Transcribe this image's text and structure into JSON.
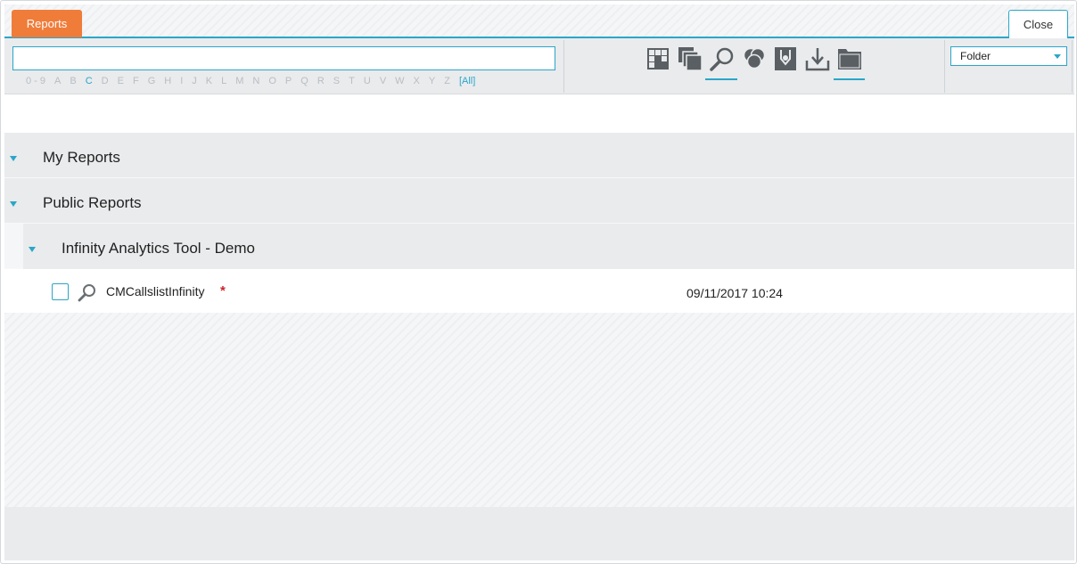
{
  "tabs": {
    "reports_label": "Reports",
    "close_label": "Close"
  },
  "search": {
    "value": "",
    "placeholder": ""
  },
  "alpha_filter": {
    "letters": [
      "0 - 9",
      "A",
      "B",
      "C",
      "D",
      "E",
      "F",
      "G",
      "H",
      "I",
      "J",
      "K",
      "L",
      "M",
      "N",
      "O",
      "P",
      "Q",
      "R",
      "S",
      "T",
      "U",
      "V",
      "W",
      "X",
      "Y",
      "Z",
      "[All]"
    ],
    "active": "C"
  },
  "toolbar_icons": [
    "grid-icon",
    "stacked-copy-icon",
    "magnifier-icon",
    "color-circles-icon",
    "badge-icon",
    "download-icon",
    "folder-icon"
  ],
  "folder_select": {
    "selected": "Folder"
  },
  "tree": {
    "my_reports": "My Reports",
    "public_reports": "Public Reports",
    "subfolder": "Infinity Analytics Tool - Demo",
    "report": {
      "name": "CMCallslistInfinity",
      "marker": "*",
      "date": "09/11/2017 10:24"
    }
  },
  "colors": {
    "accent": "#2aa6c9",
    "tab": "#f07c3a",
    "required": "#d0202a"
  }
}
